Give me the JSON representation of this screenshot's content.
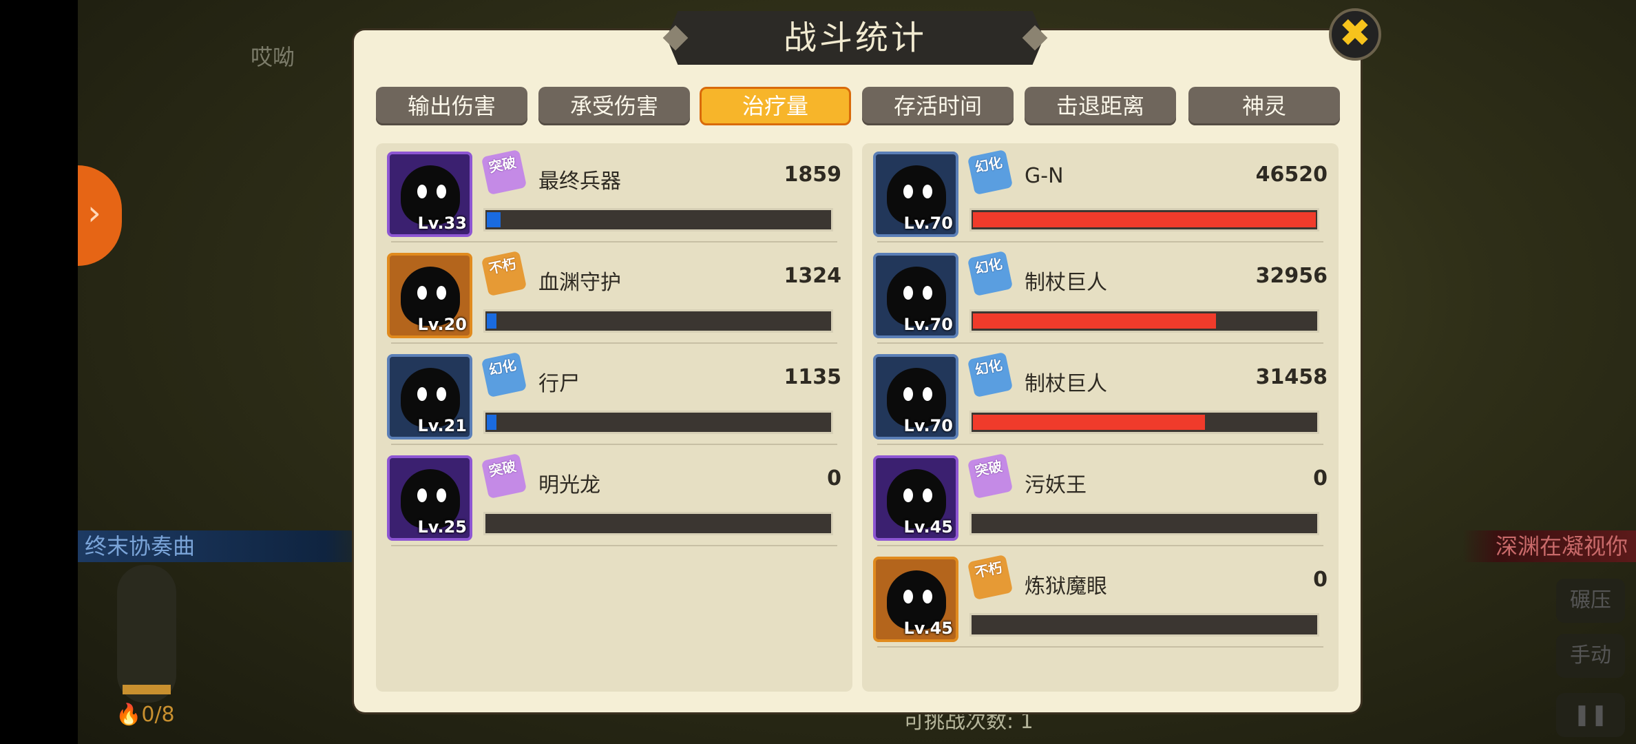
{
  "background": {
    "left_caption": "终末协奏曲",
    "right_caption": "深渊在凝视你",
    "top_text": "哎呦",
    "energy_label": "🔥0/8",
    "challenge_text": "可挑战次数: 1",
    "side_buttons": [
      "碾压",
      "手动"
    ]
  },
  "dialog": {
    "title": "战斗统计",
    "close_label": "✖",
    "tabs": [
      {
        "label": "输出伤害",
        "active": false
      },
      {
        "label": "承受伤害",
        "active": false
      },
      {
        "label": "治疗量",
        "active": true
      },
      {
        "label": "存活时间",
        "active": false
      },
      {
        "label": "击退距离",
        "active": false
      },
      {
        "label": "神灵",
        "active": false
      }
    ],
    "left_team": [
      {
        "name": "最终兵器",
        "value": "1859",
        "level": "Lv.33",
        "rarity": "突破",
        "rarity_color": "purple",
        "frame": "purple",
        "ratio": 0.04
      },
      {
        "name": "血渊守护",
        "value": "1324",
        "level": "Lv.20",
        "rarity": "不朽",
        "rarity_color": "orange",
        "frame": "legend",
        "ratio": 0.028
      },
      {
        "name": "行尸",
        "value": "1135",
        "level": "Lv.21",
        "rarity": "幻化",
        "rarity_color": "blue",
        "frame": "blue",
        "ratio": 0.024
      },
      {
        "name": "明光龙",
        "value": "0",
        "level": "Lv.25",
        "rarity": "突破",
        "rarity_color": "purple",
        "frame": "purple",
        "ratio": 0
      }
    ],
    "right_team": [
      {
        "name": "G-N",
        "value": "46520",
        "level": "Lv.70",
        "rarity": "幻化",
        "rarity_color": "blue",
        "frame": "blue",
        "ratio": 1.0
      },
      {
        "name": "制杖巨人",
        "value": "32956",
        "level": "Lv.70",
        "rarity": "幻化",
        "rarity_color": "blue",
        "frame": "blue",
        "ratio": 0.708
      },
      {
        "name": "制杖巨人",
        "value": "31458",
        "level": "Lv.70",
        "rarity": "幻化",
        "rarity_color": "blue",
        "frame": "blue",
        "ratio": 0.676
      },
      {
        "name": "污妖王",
        "value": "0",
        "level": "Lv.45",
        "rarity": "突破",
        "rarity_color": "purple",
        "frame": "purple",
        "ratio": 0
      },
      {
        "name": "炼狱魔眼",
        "value": "0",
        "level": "Lv.45",
        "rarity": "不朽",
        "rarity_color": "orange",
        "frame": "legend",
        "ratio": 0
      }
    ]
  }
}
